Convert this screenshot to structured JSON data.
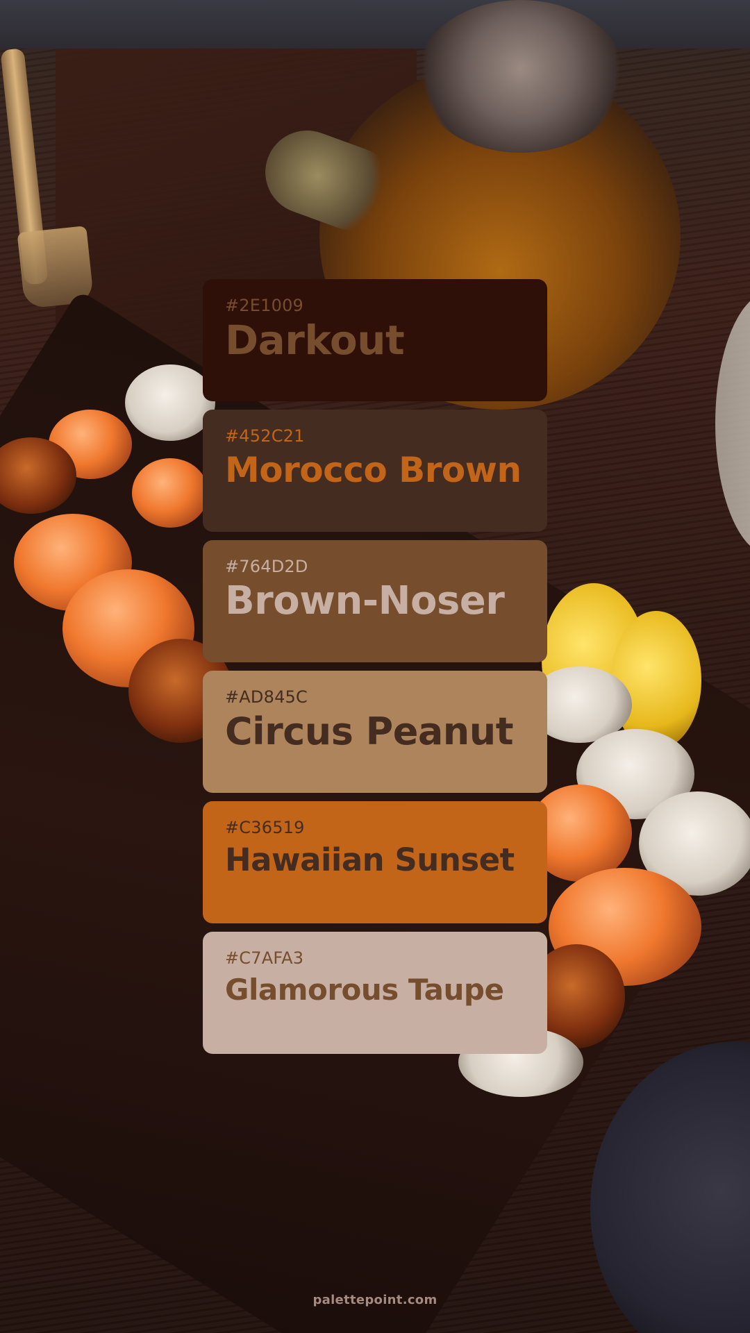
{
  "palette": [
    {
      "hex": "#2E1009",
      "name": "Darkout",
      "bg": "#2E1009",
      "text_color": "#764D2D"
    },
    {
      "hex": "#452C21",
      "name": "Morocco Brown",
      "bg": "#452C21",
      "text_color": "#C36519"
    },
    {
      "hex": "#764D2D",
      "name": "Brown-Noser",
      "bg": "#764D2D",
      "text_color": "#C7AFA3"
    },
    {
      "hex": "#AD845C",
      "name": "Circus Peanut",
      "bg": "#AD845C",
      "text_color": "#452C21"
    },
    {
      "hex": "#C36519",
      "name": "Hawaiian Sunset",
      "bg": "#C36519",
      "text_color": "#452C21"
    },
    {
      "hex": "#C7AFA3",
      "name": "Glamorous Taupe",
      "bg": "#C7AFA3",
      "text_color": "#764D2D"
    }
  ],
  "footer": {
    "site": "palettepoint.com"
  }
}
